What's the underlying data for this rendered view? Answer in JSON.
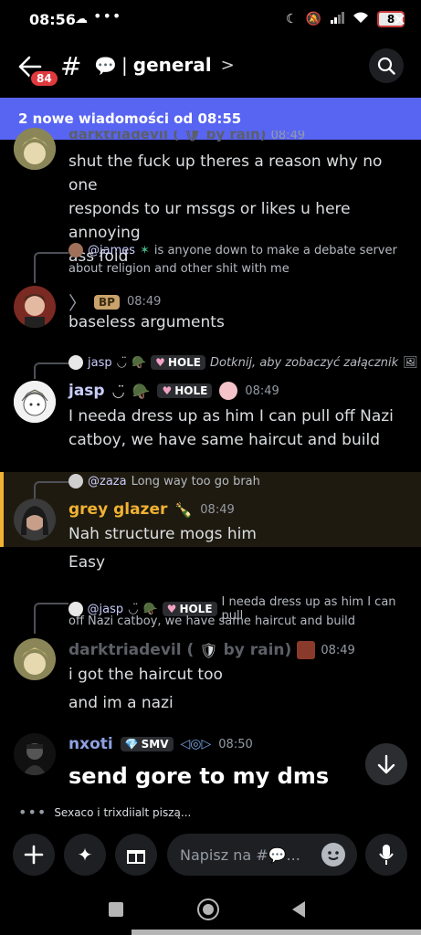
{
  "status_bar": {
    "time": "08:56",
    "battery": "8"
  },
  "header": {
    "back_badge": "84",
    "channel_name": "general"
  },
  "banner": {
    "text": "2 nowe wiadomości od 08:55"
  },
  "messages": [
    {
      "author": "darktriadevil ( 🛡 by rain)",
      "time": "08:49",
      "lines": [
        "shut the fuck up theres a reason why no one",
        "responds to ur mssgs or likes u here annoying",
        "ass foid"
      ]
    },
    {
      "reply_author": "@james",
      "reply_text_1": "is anyone down to make a debate server",
      "reply_text_2": "about religion and other shit with me",
      "author_tag": "BP",
      "time": "08:49",
      "text": "baseless arguments"
    },
    {
      "reply_author": "jasp",
      "reply_tag": "HOLE",
      "reply_text": "Dotknij, aby zobaczyć załącznik",
      "author": "jasp",
      "tag": "HOLE",
      "time": "08:49",
      "lines": [
        "I needa dress up as him I can pull off Nazi",
        "catboy, we have same haircut and build"
      ]
    },
    {
      "reply_author": "@zaza",
      "reply_text": "Long way too go brah",
      "author": "grey glazer",
      "time": "08:49",
      "lines": [
        "Nah structure mogs him",
        "Easy"
      ]
    },
    {
      "reply_author": "@jasp",
      "reply_tag": "HOLE",
      "reply_text_1": "I needa dress up as him I can pull",
      "reply_text_2": "off Nazi catboy, we have same haircut and build",
      "author": "darktriadevil (",
      "author_rest": "by rain)",
      "time": "08:49",
      "lines": [
        "i got the haircut too",
        "and im a nazi"
      ]
    },
    {
      "author": "nxoti",
      "tag": "SMV",
      "time": "08:50",
      "text": "send gore to my dms"
    }
  ],
  "typing": "Sexaco i trixdiialt piszą...",
  "composer": {
    "placeholder": "Napisz na #💬..."
  },
  "colors": {
    "accent": "#5865f2",
    "grey_glazer": "#f0b232",
    "jasp": "#c9cdfb",
    "nxoti": "#8ea1e1"
  }
}
